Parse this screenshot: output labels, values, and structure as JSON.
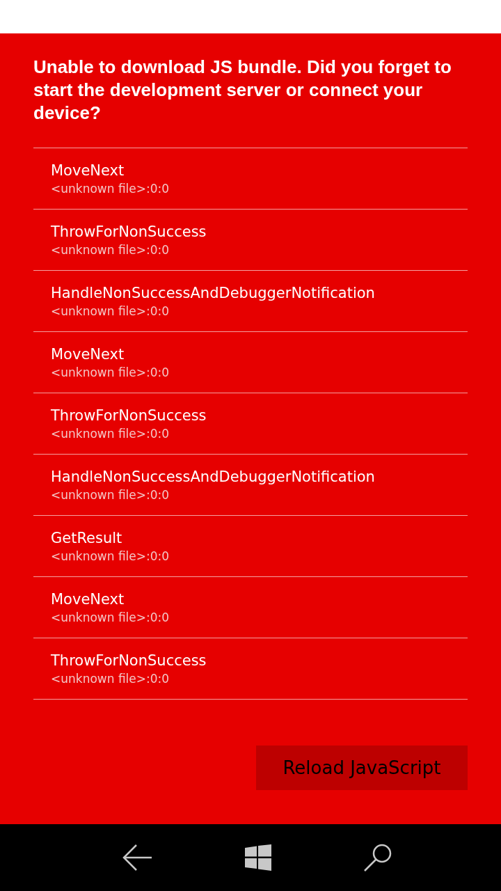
{
  "message": "Unable to download JS bundle. Did you forget to start the development server or connect your device?",
  "stack": [
    {
      "method": "MoveNext",
      "location": "<unknown file>:0:0"
    },
    {
      "method": "ThrowForNonSuccess",
      "location": "<unknown file>:0:0"
    },
    {
      "method": "HandleNonSuccessAndDebuggerNotification",
      "location": "<unknown file>:0:0"
    },
    {
      "method": "MoveNext",
      "location": "<unknown file>:0:0"
    },
    {
      "method": "ThrowForNonSuccess",
      "location": "<unknown file>:0:0"
    },
    {
      "method": "HandleNonSuccessAndDebuggerNotification",
      "location": "<unknown file>:0:0"
    },
    {
      "method": "GetResult",
      "location": "<unknown file>:0:0"
    },
    {
      "method": "MoveNext",
      "location": "<unknown file>:0:0"
    },
    {
      "method": "ThrowForNonSuccess",
      "location": "<unknown file>:0:0"
    }
  ],
  "reload_button": "Reload JavaScript"
}
